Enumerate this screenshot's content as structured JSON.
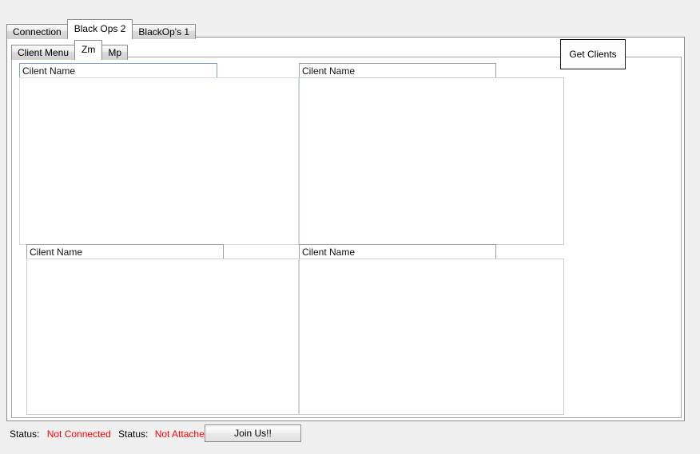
{
  "window": {
    "background": "#f0f0f0"
  },
  "outer_tabs": {
    "items": [
      {
        "label": "Connection",
        "selected": false
      },
      {
        "label": "Black Ops 2",
        "selected": true
      },
      {
        "label": "BlackOp's 1",
        "selected": false
      }
    ]
  },
  "inner_tabs": {
    "items": [
      {
        "label": "Client Menu",
        "selected": false
      },
      {
        "label": "Zm",
        "selected": true
      },
      {
        "label": "Mp",
        "selected": false
      }
    ]
  },
  "client_panels": [
    {
      "name": "top-left",
      "textbox_value": "Cilent Name",
      "textbox_placeholder": "Cilent Name",
      "list_items": []
    },
    {
      "name": "top-right",
      "textbox_value": "Cilent Name",
      "textbox_placeholder": "Cilent Name",
      "list_items": []
    },
    {
      "name": "bottom-left",
      "textbox_value": "Cilent Name",
      "textbox_placeholder": "Cilent Name",
      "list_items": []
    },
    {
      "name": "bottom-right",
      "textbox_value": "Cilent Name",
      "textbox_placeholder": "Cilent Name",
      "list_items": []
    }
  ],
  "buttons": {
    "get_clients": "Get Clients",
    "join_us": "Join Us!!"
  },
  "status_bar": {
    "connection": {
      "label": "Status:",
      "value": "Not Connected"
    },
    "attach": {
      "label": "Status:",
      "value": "Not Attached"
    },
    "value_color": "#ff0000"
  }
}
